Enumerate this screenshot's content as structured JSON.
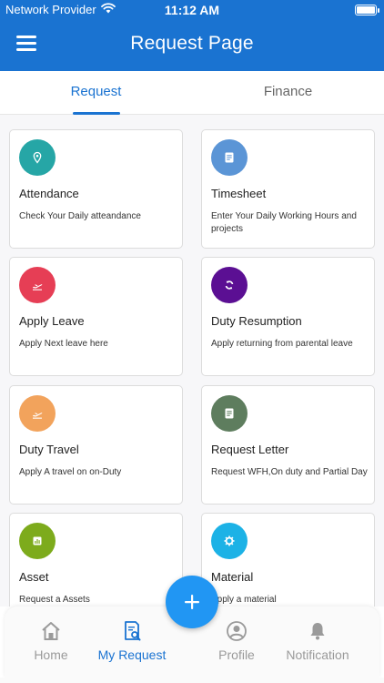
{
  "status_bar": {
    "carrier": "Network Provider",
    "time": "11:12 AM",
    "wifi_icon": "wifi-icon",
    "battery_icon": "battery-icon"
  },
  "header": {
    "title": "Request Page",
    "menu_icon": "hamburger-menu-icon",
    "background_color": "#1a73d1"
  },
  "tabs": [
    {
      "label": "Request",
      "active": true
    },
    {
      "label": "Finance",
      "active": false
    }
  ],
  "cards": [
    {
      "title": "Attendance",
      "description": "Check Your Daily atteandance",
      "icon": "location-pin-icon",
      "color": "#26a6a6"
    },
    {
      "title": "Timesheet",
      "description": "Enter Your Daily Working Hours and projects",
      "icon": "document-icon",
      "color": "#5b95d6"
    },
    {
      "title": "Apply Leave",
      "description": "Apply Next leave here",
      "icon": "plane-departure-icon",
      "color": "#e63e55"
    },
    {
      "title": "Duty Resumption",
      "description": "Apply returning from parental leave",
      "icon": "refresh-icon",
      "color": "#5b0f93"
    },
    {
      "title": "Duty Travel",
      "description": "Apply A travel on on-Duty",
      "icon": "plane-departure-icon",
      "color": "#f2a35c"
    },
    {
      "title": "Request Letter",
      "description": "Request WFH,On duty and Partial Day",
      "icon": "document-icon",
      "color": "#5e7d5e"
    },
    {
      "title": "Asset",
      "description": "Request a Assets",
      "icon": "chart-icon",
      "color": "#7dab1c"
    },
    {
      "title": "Material",
      "description": "Apply a material",
      "icon": "gear-icon",
      "color": "#1cb2e6"
    }
  ],
  "fab": {
    "icon": "plus-icon",
    "color": "#2196f3"
  },
  "bottom_nav": [
    {
      "label": "Home",
      "icon": "home-icon",
      "active": false
    },
    {
      "label": "My Request",
      "icon": "request-search-icon",
      "active": true
    },
    {
      "label": "Profile",
      "icon": "profile-icon",
      "active": false
    },
    {
      "label": "Notification",
      "icon": "bell-icon",
      "active": false
    }
  ]
}
